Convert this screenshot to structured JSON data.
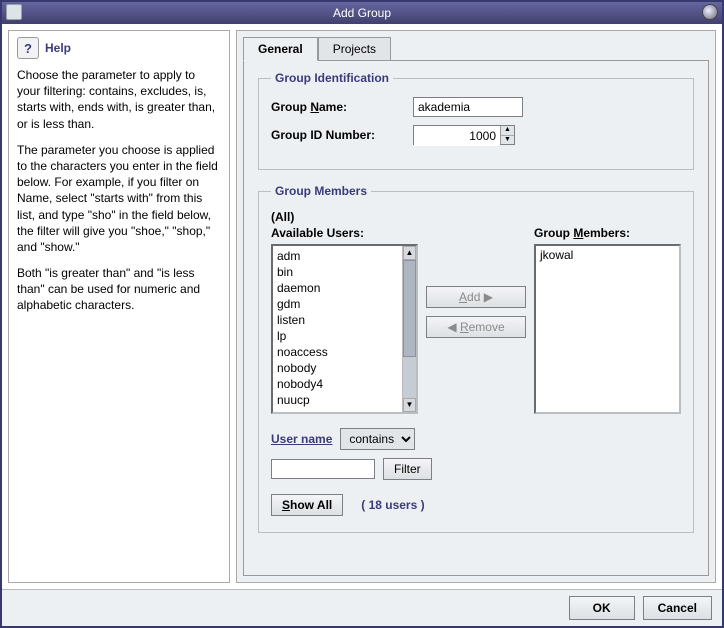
{
  "window": {
    "title": "Add Group"
  },
  "help": {
    "heading": "Help",
    "p1": "Choose the parameter to apply to your filtering: contains, excludes, is, starts with, ends with, is greater than, or is less than.",
    "p2": "The parameter you choose is applied to the characters you enter in the field below. For example, if you filter on Name, select \"starts with\" from this list, and type \"sho\" in the field below, the filter will give you \"shoe,\" \"shop,\" and \"show.\"",
    "p3": "Both \"is greater than\" and \"is less than\" can be used for numeric and alphabetic characters."
  },
  "tabs": {
    "general": "General",
    "projects": "Projects"
  },
  "group_id": {
    "legend": "Group Identification",
    "name_label_pre": "Group ",
    "name_label_u": "N",
    "name_label_post": "ame:",
    "name_value": "akademia",
    "id_label": "Group ID Number:",
    "id_value": "1000"
  },
  "members": {
    "legend": "Group Members",
    "all": "(All)",
    "available_label": "Available Users:",
    "members_label_pre": "Group ",
    "members_label_u": "M",
    "members_label_post": "embers:",
    "available": [
      "adm",
      "bin",
      "daemon",
      "gdm",
      "listen",
      "lp",
      "noaccess",
      "nobody",
      "nobody4",
      "nuucp"
    ],
    "current": [
      "jkowal"
    ],
    "add_u": "A",
    "add_post": "dd",
    "remove_u": "R",
    "remove_post": "emove",
    "filter_label": "User name",
    "filter_op": "contains",
    "filter_value": "",
    "filter_btn": "Filter",
    "showall_u": "S",
    "showall_post": "how All",
    "count": "( 18 users )"
  },
  "footer": {
    "ok": "OK",
    "cancel": "Cancel"
  }
}
